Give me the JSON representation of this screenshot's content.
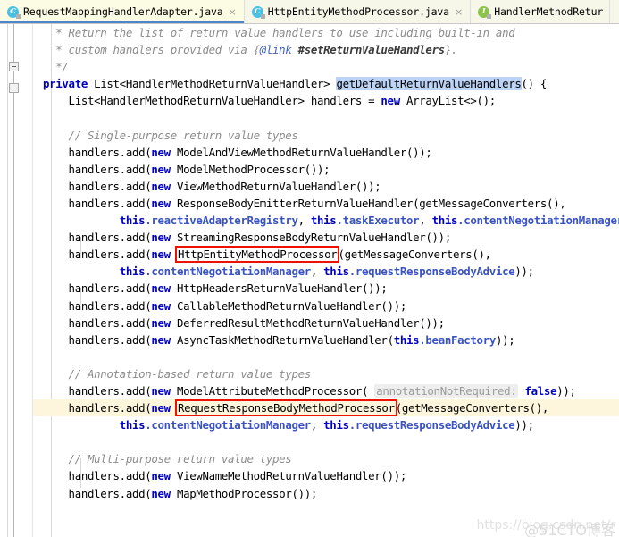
{
  "window": {
    "app": "IntelliJ IDEA Editor",
    "accent_active_tab_underline": "#4a86c8",
    "caret_line_color": "#fdf6dd",
    "annotation_box_color": "#ee1100"
  },
  "tabs": [
    {
      "label": "RequestMappingHandlerAdapter.java",
      "icon": "java-class-icon",
      "icon_letter": "C",
      "active": true,
      "close_label": "×"
    },
    {
      "label": "HttpEntityMethodProcessor.java",
      "icon": "java-class-icon",
      "icon_letter": "C",
      "active": false,
      "close_label": "×"
    },
    {
      "label": "HandlerMethodRetur",
      "icon": "java-interface-icon",
      "icon_letter": "I",
      "active": false,
      "close_label": ""
    }
  ],
  "code": {
    "lines": [
      {
        "id": "l1",
        "text": "  * Return the list of return value handlers to use including built-in and"
      },
      {
        "id": "l2",
        "text": "  * custom handlers provided via {@link #setReturnValueHandlers}."
      },
      {
        "id": "l3",
        "text": "  */"
      },
      {
        "id": "l4",
        "text": "private List<HandlerMethodReturnValueHandler> getDefaultReturnValueHandlers() {"
      },
      {
        "id": "l5",
        "text": "    List<HandlerMethodReturnValueHandler> handlers = new ArrayList<>();"
      },
      {
        "id": "l6",
        "text": ""
      },
      {
        "id": "l7",
        "text": "    // Single-purpose return value types"
      },
      {
        "id": "l8",
        "text": "    handlers.add(new ModelAndViewMethodReturnValueHandler());"
      },
      {
        "id": "l9",
        "text": "    handlers.add(new ModelMethodProcessor());"
      },
      {
        "id": "l10",
        "text": "    handlers.add(new ViewMethodReturnValueHandler());"
      },
      {
        "id": "l11",
        "text": "    handlers.add(new ResponseBodyEmitterReturnValueHandler(getMessageConverters(),"
      },
      {
        "id": "l12",
        "text": "            this.reactiveAdapterRegistry, this.taskExecutor, this.contentNegotiationManager));"
      },
      {
        "id": "l13",
        "text": "    handlers.add(new StreamingResponseBodyReturnValueHandler());"
      },
      {
        "id": "l14",
        "text": "    handlers.add(new HttpEntityMethodProcessor(getMessageConverters(),"
      },
      {
        "id": "l15",
        "text": "            this.contentNegotiationManager, this.requestResponseBodyAdvice));"
      },
      {
        "id": "l16",
        "text": "    handlers.add(new HttpHeadersReturnValueHandler());"
      },
      {
        "id": "l17",
        "text": "    handlers.add(new CallableMethodReturnValueHandler());"
      },
      {
        "id": "l18",
        "text": "    handlers.add(new DeferredResultMethodReturnValueHandler());"
      },
      {
        "id": "l19",
        "text": "    handlers.add(new AsyncTaskMethodReturnValueHandler(this.beanFactory));"
      },
      {
        "id": "l20",
        "text": ""
      },
      {
        "id": "l21",
        "text": "    // Annotation-based return value types"
      },
      {
        "id": "l22",
        "text": "    handlers.add(new ModelAttributeMethodProcessor( annotationNotRequired: false));"
      },
      {
        "id": "l23",
        "text": "    handlers.add(new RequestResponseBodyMethodProcessor(getMessageConverters(),"
      },
      {
        "id": "l24",
        "text": "            this.contentNegotiationManager, this.requestResponseBodyAdvice));"
      },
      {
        "id": "l25",
        "text": ""
      },
      {
        "id": "l26",
        "text": "    // Multi-purpose return value types"
      },
      {
        "id": "l27",
        "text": "    handlers.add(new ViewNameMethodReturnValueHandler());"
      },
      {
        "id": "l28",
        "text": "    handlers.add(new MapMethodProcessor());"
      }
    ],
    "tokens": {
      "kw_private": "private",
      "kw_new": "new",
      "kw_this": "this",
      "kw_false": "false",
      "selected_method": "getDefaultReturnValueHandlers",
      "param_hint": "annotationNotRequired:",
      "javadoc_link_tag": "@link",
      "javadoc_link_ref": "#setReturnValueHandlers"
    },
    "annotations": [
      {
        "name": "HttpEntityMethodProcessor",
        "line": "l14"
      },
      {
        "name": "RequestResponseBodyMethodProcessor",
        "line": "l23"
      }
    ],
    "highlighted_line": "l23"
  },
  "watermark": {
    "url": "https://blog.csdn.net/r",
    "brand": "@51CTO博客"
  }
}
